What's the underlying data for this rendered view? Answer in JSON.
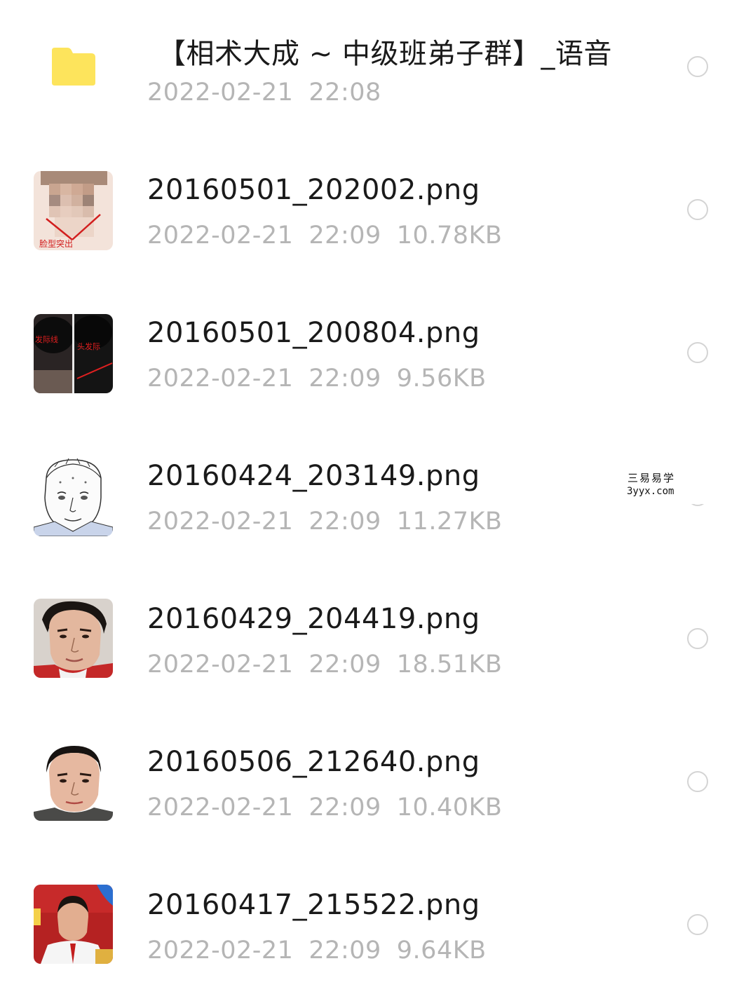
{
  "files": [
    {
      "name": "【相术大成 ~ 中级班弟子群】_语音",
      "date": "2022-02-21",
      "time": "22:08",
      "size": "",
      "icon": "folder-icon"
    },
    {
      "name": "20160501_202002.png",
      "date": "2022-02-21",
      "time": "22:09",
      "size": "10.78KB",
      "icon": "face-diagram-thumbnail"
    },
    {
      "name": "20160501_200804.png",
      "date": "2022-02-21",
      "time": "22:09",
      "size": "9.56KB",
      "icon": "hairline-photo-thumbnail"
    },
    {
      "name": "20160424_203149.png",
      "date": "2022-02-21",
      "time": "22:09",
      "size": "11.27KB",
      "icon": "face-sketch-thumbnail"
    },
    {
      "name": "20160429_204419.png",
      "date": "2022-02-21",
      "time": "22:09",
      "size": "18.51KB",
      "icon": "portrait-photo-thumbnail"
    },
    {
      "name": "20160506_212640.png",
      "date": "2022-02-21",
      "time": "22:09",
      "size": "10.40KB",
      "icon": "portrait-photo-thumbnail"
    },
    {
      "name": "20160417_215522.png",
      "date": "2022-02-21",
      "time": "22:09",
      "size": "9.64KB",
      "icon": "event-photo-thumbnail"
    }
  ],
  "thumb_labels": {
    "row1": "脸型突出",
    "row2_left": "发际线",
    "row2_right": "头发际"
  },
  "watermark": {
    "line1": "三易易学",
    "line2": "3yyx.com"
  },
  "colors": {
    "folder": "#fde45c",
    "name": "#1a1a1a",
    "meta": "#b5b5b5",
    "radio": "#d4d4d4"
  }
}
